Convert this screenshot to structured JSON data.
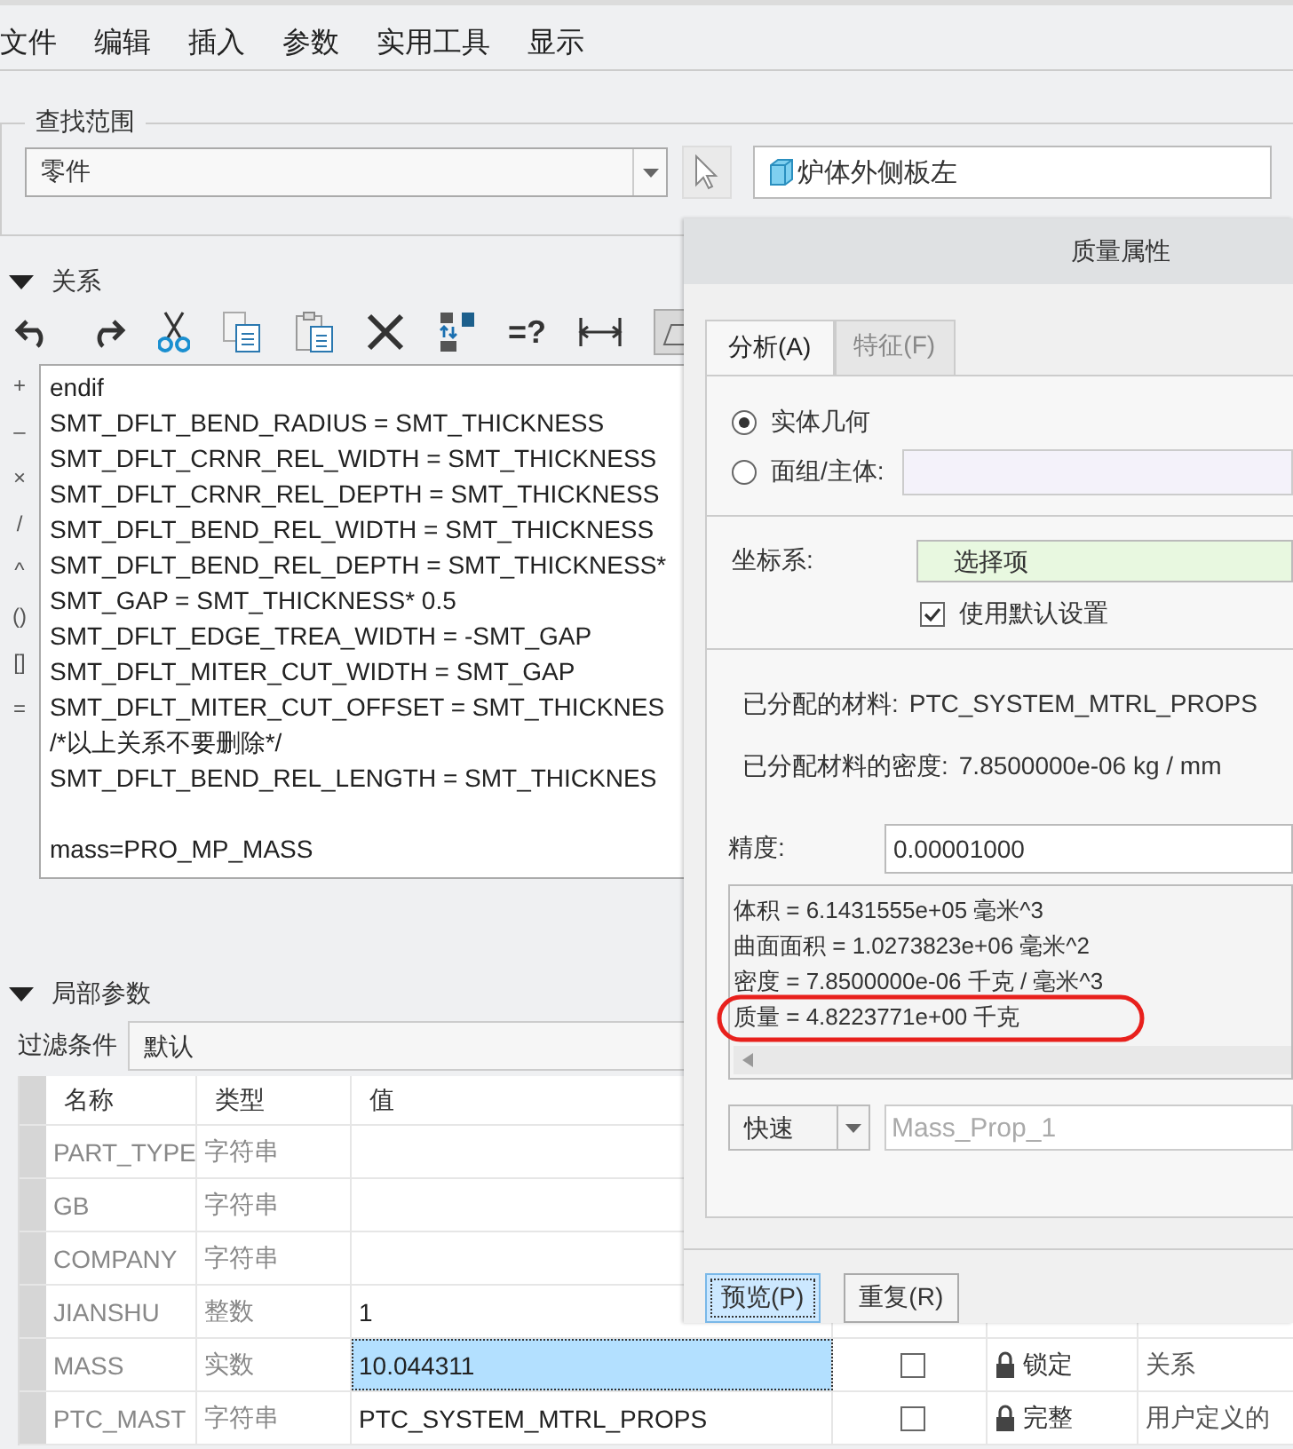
{
  "menu": [
    "文件",
    "编辑",
    "插入",
    "参数",
    "实用工具",
    "显示"
  ],
  "find_scope": {
    "title": "查找范围",
    "scope": "零件",
    "selection": "炉体外侧板左"
  },
  "relations": {
    "title": "关系",
    "expanded": true,
    "toolbar_text": "=?",
    "operators": [
      "+",
      "–",
      "×",
      "/",
      "^",
      "()",
      "[]",
      "="
    ],
    "text": "endif\nSMT_DFLT_BEND_RADIUS = SMT_THICKNESS\nSMT_DFLT_CRNR_REL_WIDTH = SMT_THICKNESS\nSMT_DFLT_CRNR_REL_DEPTH = SMT_THICKNESS\nSMT_DFLT_BEND_REL_WIDTH = SMT_THICKNESS\nSMT_DFLT_BEND_REL_DEPTH = SMT_THICKNESS*\nSMT_GAP = SMT_THICKNESS* 0.5\nSMT_DFLT_EDGE_TREA_WIDTH = -SMT_GAP\nSMT_DFLT_MITER_CUT_WIDTH = SMT_GAP\nSMT_DFLT_MITER_CUT_OFFSET = SMT_THICKNES\n/*以上关系不要删除*/\nSMT_DFLT_BEND_REL_LENGTH = SMT_THICKNES\n\nmass=PRO_MP_MASS"
  },
  "local_parameters": {
    "title": "局部参数",
    "expanded": true,
    "filter_label": "过滤条件",
    "filter": "默认",
    "columns": [
      "名称",
      "类型",
      "值"
    ],
    "rows": [
      {
        "name": "PART_TYPE",
        "type": "字符串",
        "selected": false
      },
      {
        "name": "GB",
        "type": "字符串",
        "selected": false
      },
      {
        "name": "COMPANY",
        "type": "字符串",
        "selected": false
      },
      {
        "name": "JIANSHU",
        "type": "整数",
        "value": "1",
        "selected": false
      },
      {
        "name": "MASS",
        "type": "实数",
        "value": "10.044311",
        "selected": true,
        "checked": false,
        "access": "锁定",
        "source": "关系"
      },
      {
        "name": "PTC_MAST",
        "type": "字符串",
        "value": "PTC_SYSTEM_MTRL_PROPS",
        "selected": false,
        "checked": false,
        "access": "完整",
        "source": "用户定义的"
      }
    ]
  },
  "dialog": {
    "title": "质量属性",
    "tabs": [
      {
        "label": "分析(A)",
        "selected": true
      },
      {
        "label": "特征(F)",
        "selected": false
      }
    ],
    "geometry_options": [
      {
        "label": "实体几何",
        "selected": true
      },
      {
        "label": "面组/主体:",
        "selected": false
      }
    ],
    "csys_label": "坐标系:",
    "csys_value": "选择项",
    "use_default": {
      "label": "使用默认设置",
      "checked": true
    },
    "material_label": "已分配的材料:",
    "material": "PTC_SYSTEM_MTRL_PROPS",
    "density_label": "已分配材料的密度:",
    "density": "7.8500000e-06  kg / mm",
    "accuracy_label": "精度:",
    "accuracy": "0.00001000",
    "results": [
      {
        "text": "体积 =  6.1431555e+05  毫米^3",
        "circled": false
      },
      {
        "text": "曲面面积 =  1.0273823e+06  毫米^2",
        "circled": false
      },
      {
        "text": "密度 =  7.8500000e-06 千克 / 毫米^3",
        "circled": false
      },
      {
        "text": "质量 =  4.8223771e+00 千克",
        "circled": true
      }
    ],
    "mode": "快速",
    "name_field": {
      "value": "Mass_Prop_1",
      "disabled": true
    },
    "buttons": [
      {
        "label": "预览(P)",
        "focused": true
      },
      {
        "label": "重复(R)",
        "focused": false
      }
    ]
  }
}
